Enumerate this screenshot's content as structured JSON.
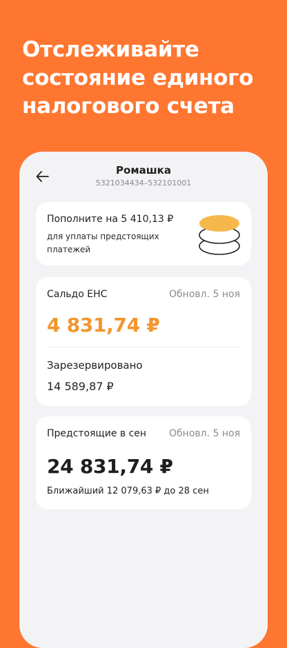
{
  "promo": {
    "line1": "Отслеживайте",
    "line2": "состояние единого",
    "line3": "налогового счета"
  },
  "header": {
    "title": "Ромашка",
    "subtitle": "5321034434–532101001",
    "back_icon": "arrow-left-icon"
  },
  "topup": {
    "title": "Пополните на 5 410,13 ₽",
    "description": "для уплаты предстоящих платежей",
    "icon": "coins-stack-icon",
    "coin_color": "#F6B84B"
  },
  "balance": {
    "label": "Сальдо ЕНС",
    "updated": "Обновл. 5 ноя",
    "amount": "4 831,74 ₽",
    "reserved_label": "Зарезервировано",
    "reserved_amount": "14 589,87 ₽",
    "accent": "#F2962E"
  },
  "upcoming": {
    "label": "Предстоящие в сен",
    "updated": "Обновл. 5 ноя",
    "amount": "24 831,74 ₽",
    "nearest": "Ближайший 12 079,63 ₽ до 28 сен"
  },
  "colors": {
    "background": "#FF7630",
    "screen": "#F3F3F5"
  }
}
